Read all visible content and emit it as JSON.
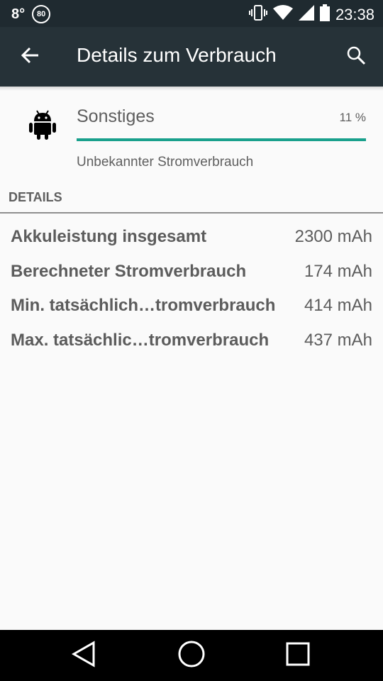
{
  "status_bar": {
    "temperature": "8°",
    "badge": "80",
    "time": "23:38",
    "icons": [
      "vibrate-icon",
      "wifi-icon",
      "signal-icon",
      "battery-icon"
    ]
  },
  "app_bar": {
    "title": "Details zum Verbrauch",
    "icons": [
      "back-arrow-icon",
      "search-icon"
    ]
  },
  "item": {
    "icon": "android-icon",
    "name": "Sonstiges",
    "percent_label": "11 %",
    "summary": "Unbekannter Stromverbrauch",
    "progress_fraction": 1.0
  },
  "details": {
    "section_title": "DETAILS",
    "rows": [
      {
        "label": "Akkuleistung insgesamt",
        "value": "2300 mAh"
      },
      {
        "label": "Berechneter Stromverbrauch",
        "value": "174 mAh"
      },
      {
        "label": "Min. tatsächlich…tromverbrauch",
        "value": "414 mAh"
      },
      {
        "label": "Max. tatsächlic…tromverbrauch",
        "value": "437 mAh"
      }
    ]
  },
  "nav_bar": {
    "icons": [
      "back-triangle-icon",
      "home-circle-icon",
      "recents-square-icon"
    ]
  },
  "colors": {
    "app_bar": "#263238",
    "status_bar": "#1f2a30",
    "accent": "#19a08c",
    "text": "#5c5c5c"
  }
}
